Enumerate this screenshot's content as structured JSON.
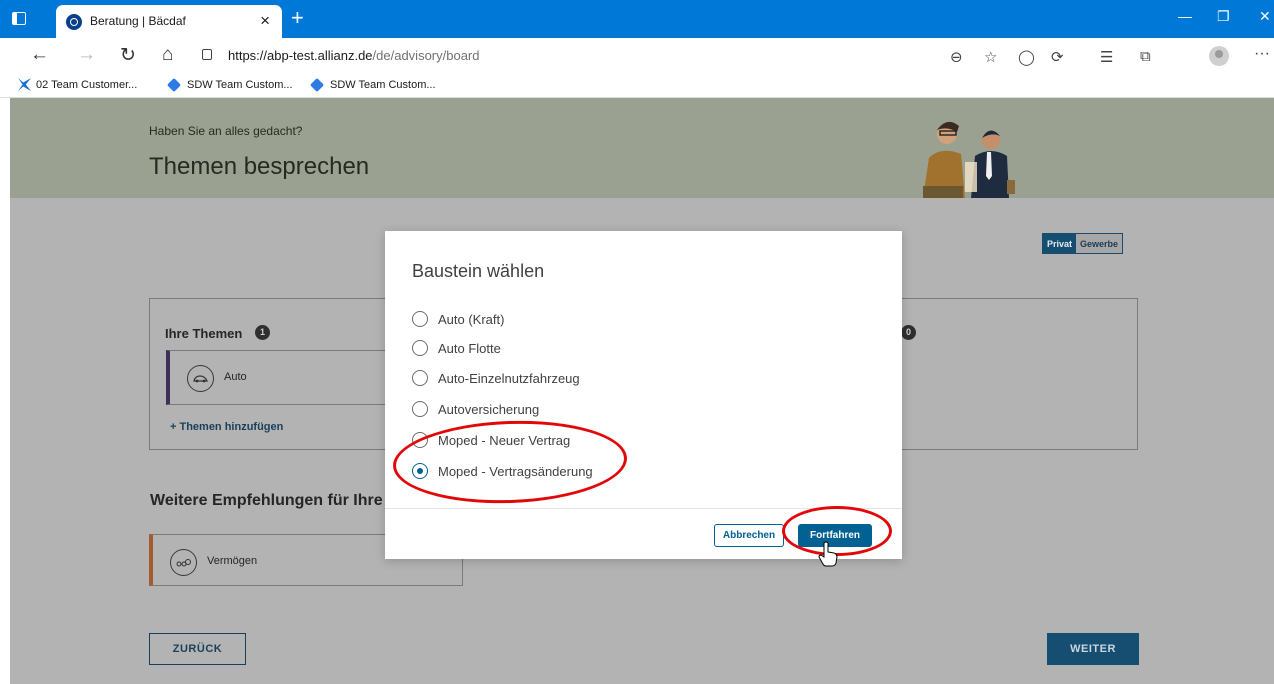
{
  "browser": {
    "tab_title": "Beratung | Bäcdaf",
    "tab_close": "×",
    "new_tab": "+",
    "window_controls": {
      "minimize": "—",
      "maximize": "❐",
      "close": "✕"
    },
    "nav": {
      "back": "←",
      "forward": "→",
      "reload": "↻",
      "home": "⌂"
    },
    "url_host": "https://abp-test.allianz.de",
    "url_path": "/de/advisory/board",
    "more": "···",
    "bookmarks": [
      "02 Team Customer...",
      "SDW Team Custom...",
      "SDW Team Custom..."
    ]
  },
  "header": {
    "subtitle": "Haben Sie an alles gedacht?",
    "title": "Themen besprechen"
  },
  "segment": {
    "options": [
      "Privat",
      "Gewerbe"
    ],
    "selected": "Privat"
  },
  "themes": {
    "title": "Ihre Themen",
    "count": "1",
    "other_count": "0",
    "items": [
      {
        "label": "Auto",
        "icon": "car-icon"
      }
    ],
    "add_label": "+ Themen hinzufügen"
  },
  "recommendations": {
    "title": "Weitere Empfehlungen für Ihre (",
    "items": [
      {
        "label": "Vermögen",
        "icon": "wealth-icon"
      }
    ]
  },
  "footer": {
    "back_label": "ZURÜCK",
    "next_label": "WEITER"
  },
  "modal": {
    "title": "Baustein wählen",
    "options": [
      "Auto (Kraft)",
      "Auto Flotte",
      "Auto-Einzelnutzfahrzeug",
      "Autoversicherung",
      "Moped - Neuer Vertrag",
      "Moped - Vertragsänderung"
    ],
    "selected_index": 5,
    "cancel_label": "Abbrechen",
    "continue_label": "Fortfahren"
  },
  "colors": {
    "titlebar": "#0078d7",
    "primary": "#006192",
    "annotation": "#e2080a"
  }
}
